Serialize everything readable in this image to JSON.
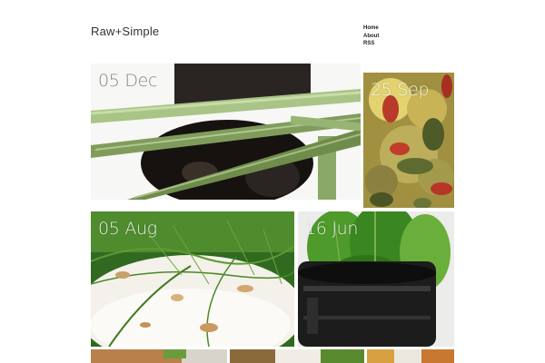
{
  "site": {
    "title": "Raw+Simple"
  },
  "nav": {
    "items": [
      "Home",
      "About",
      "RSS"
    ]
  },
  "posts": [
    {
      "date": "05 Dec",
      "image": "asparagus-on-portobello"
    },
    {
      "date": "25 Sep",
      "image": "seed-and-goji-salad"
    },
    {
      "date": "05 Aug",
      "image": "dill-on-cheese"
    },
    {
      "date": "16 Jun",
      "image": "spinach-in-black-cup"
    },
    {
      "date": "",
      "image": "bread-with-greens"
    },
    {
      "date": "",
      "image": "salad-bowl"
    },
    {
      "date": "",
      "image": "orange-dish"
    }
  ]
}
